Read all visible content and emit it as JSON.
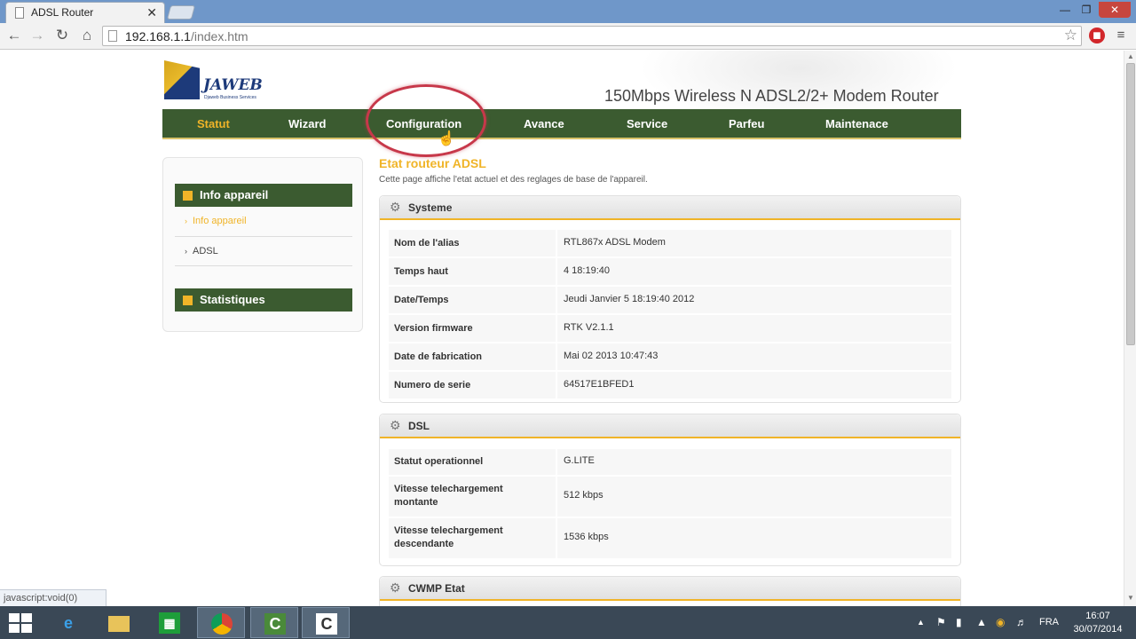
{
  "browser": {
    "tab_title": "ADSL Router",
    "tab_close": "✕",
    "url_host": "192.168.1.1",
    "url_path": "/index.htm",
    "status_text": "javascript:void(0)"
  },
  "page": {
    "product_title": "150Mbps Wireless N ADSL2/2+ Modem Router",
    "logo_text": "JAWEB",
    "logo_sub": "Djaweb Business Services",
    "nav": [
      "Statut",
      "Wizard",
      "Configuration",
      "Avance",
      "Service",
      "Parfeu",
      "Maintenace"
    ],
    "nav_active_index": 0,
    "sidebar": {
      "section1": "Info appareil",
      "items": [
        "Info appareil",
        "ADSL"
      ],
      "section2": "Statistiques"
    },
    "content_title": "Etat routeur ADSL",
    "content_desc": "Cette page affiche l'etat actuel et des reglages de base de l'appareil.",
    "systeme": {
      "title": "Systeme",
      "rows": [
        {
          "k": "Nom de l'alias",
          "v": "RTL867x ADSL Modem"
        },
        {
          "k": "Temps haut",
          "v": "4 18:19:40"
        },
        {
          "k": "Date/Temps",
          "v": "Jeudi Janvier 5 18:19:40 2012"
        },
        {
          "k": "Version firmware",
          "v": "RTK V2.1.1"
        },
        {
          "k": "Date de fabrication",
          "v": "Mai 02 2013 10:47:43"
        },
        {
          "k": "Numero de serie",
          "v": "64517E1BFED1"
        }
      ]
    },
    "dsl": {
      "title": "DSL",
      "rows": [
        {
          "k": "Statut operationnel",
          "v": "G.LITE"
        },
        {
          "k": "Vitesse telechargement montante",
          "v": "512 kbps"
        },
        {
          "k": "Vitesse telechargement descendante",
          "v": "1536 kbps"
        }
      ]
    },
    "cwmp": {
      "title": "CWMP Etat"
    }
  },
  "taskbar": {
    "language": "FRA",
    "time": "16:07",
    "date": "30/07/2014"
  },
  "colors": {
    "nav_bg": "#3b5b30",
    "accent": "#f0b428",
    "highlight_circle": "#c7384a"
  }
}
